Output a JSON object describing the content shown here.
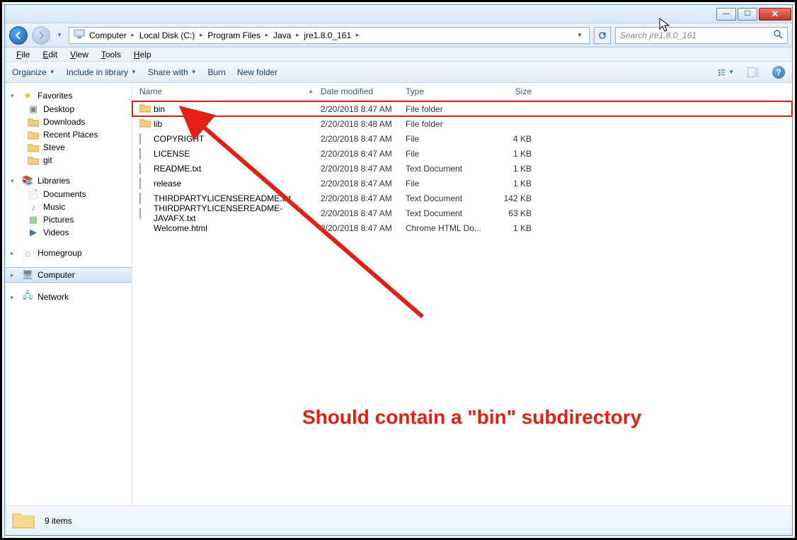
{
  "breadcrumb": [
    "Computer",
    "Local Disk (C:)",
    "Program Files",
    "Java",
    "jre1.8.0_161"
  ],
  "search_placeholder": "Search jre1.8.0_161",
  "menus": {
    "file": "File",
    "edit": "Edit",
    "view": "View",
    "tools": "Tools",
    "help": "Help"
  },
  "toolbar": {
    "organize": "Organize",
    "include": "Include in library",
    "share": "Share with",
    "burn": "Burn",
    "newfolder": "New folder"
  },
  "nav": {
    "favorites": "Favorites",
    "fav_items": [
      "Desktop",
      "Downloads",
      "Recent Places",
      "Steve",
      "git"
    ],
    "libraries": "Libraries",
    "lib_items": [
      "Documents",
      "Music",
      "Pictures",
      "Videos"
    ],
    "homegroup": "Homegroup",
    "computer": "Computer",
    "network": "Network"
  },
  "columns": {
    "name": "Name",
    "modified": "Date modified",
    "type": "Type",
    "size": "Size"
  },
  "files": [
    {
      "icon": "folder",
      "name": "bin",
      "modified": "2/20/2018 8:47 AM",
      "type": "File folder",
      "size": "",
      "highlight": true
    },
    {
      "icon": "folder",
      "name": "lib",
      "modified": "2/20/2018 8:48 AM",
      "type": "File folder",
      "size": ""
    },
    {
      "icon": "text",
      "name": "COPYRIGHT",
      "modified": "2/20/2018 8:47 AM",
      "type": "File",
      "size": "4 KB"
    },
    {
      "icon": "text",
      "name": "LICENSE",
      "modified": "2/20/2018 8:47 AM",
      "type": "File",
      "size": "1 KB"
    },
    {
      "icon": "text",
      "name": "README.txt",
      "modified": "2/20/2018 8:47 AM",
      "type": "Text Document",
      "size": "1 KB"
    },
    {
      "icon": "text",
      "name": "release",
      "modified": "2/20/2018 8:47 AM",
      "type": "File",
      "size": "1 KB"
    },
    {
      "icon": "text",
      "name": "THIRDPARTYLICENSEREADME.txt",
      "modified": "2/20/2018 8:47 AM",
      "type": "Text Document",
      "size": "142 KB"
    },
    {
      "icon": "text",
      "name": "THIRDPARTYLICENSEREADME-JAVAFX.txt",
      "modified": "2/20/2018 8:47 AM",
      "type": "Text Document",
      "size": "63 KB"
    },
    {
      "icon": "chrome",
      "name": "Welcome.html",
      "modified": "2/20/2018 8:47 AM",
      "type": "Chrome HTML Do...",
      "size": "1 KB"
    }
  ],
  "status": {
    "count": "9 items"
  },
  "annotation": "Should contain a \"bin\" subdirectory"
}
